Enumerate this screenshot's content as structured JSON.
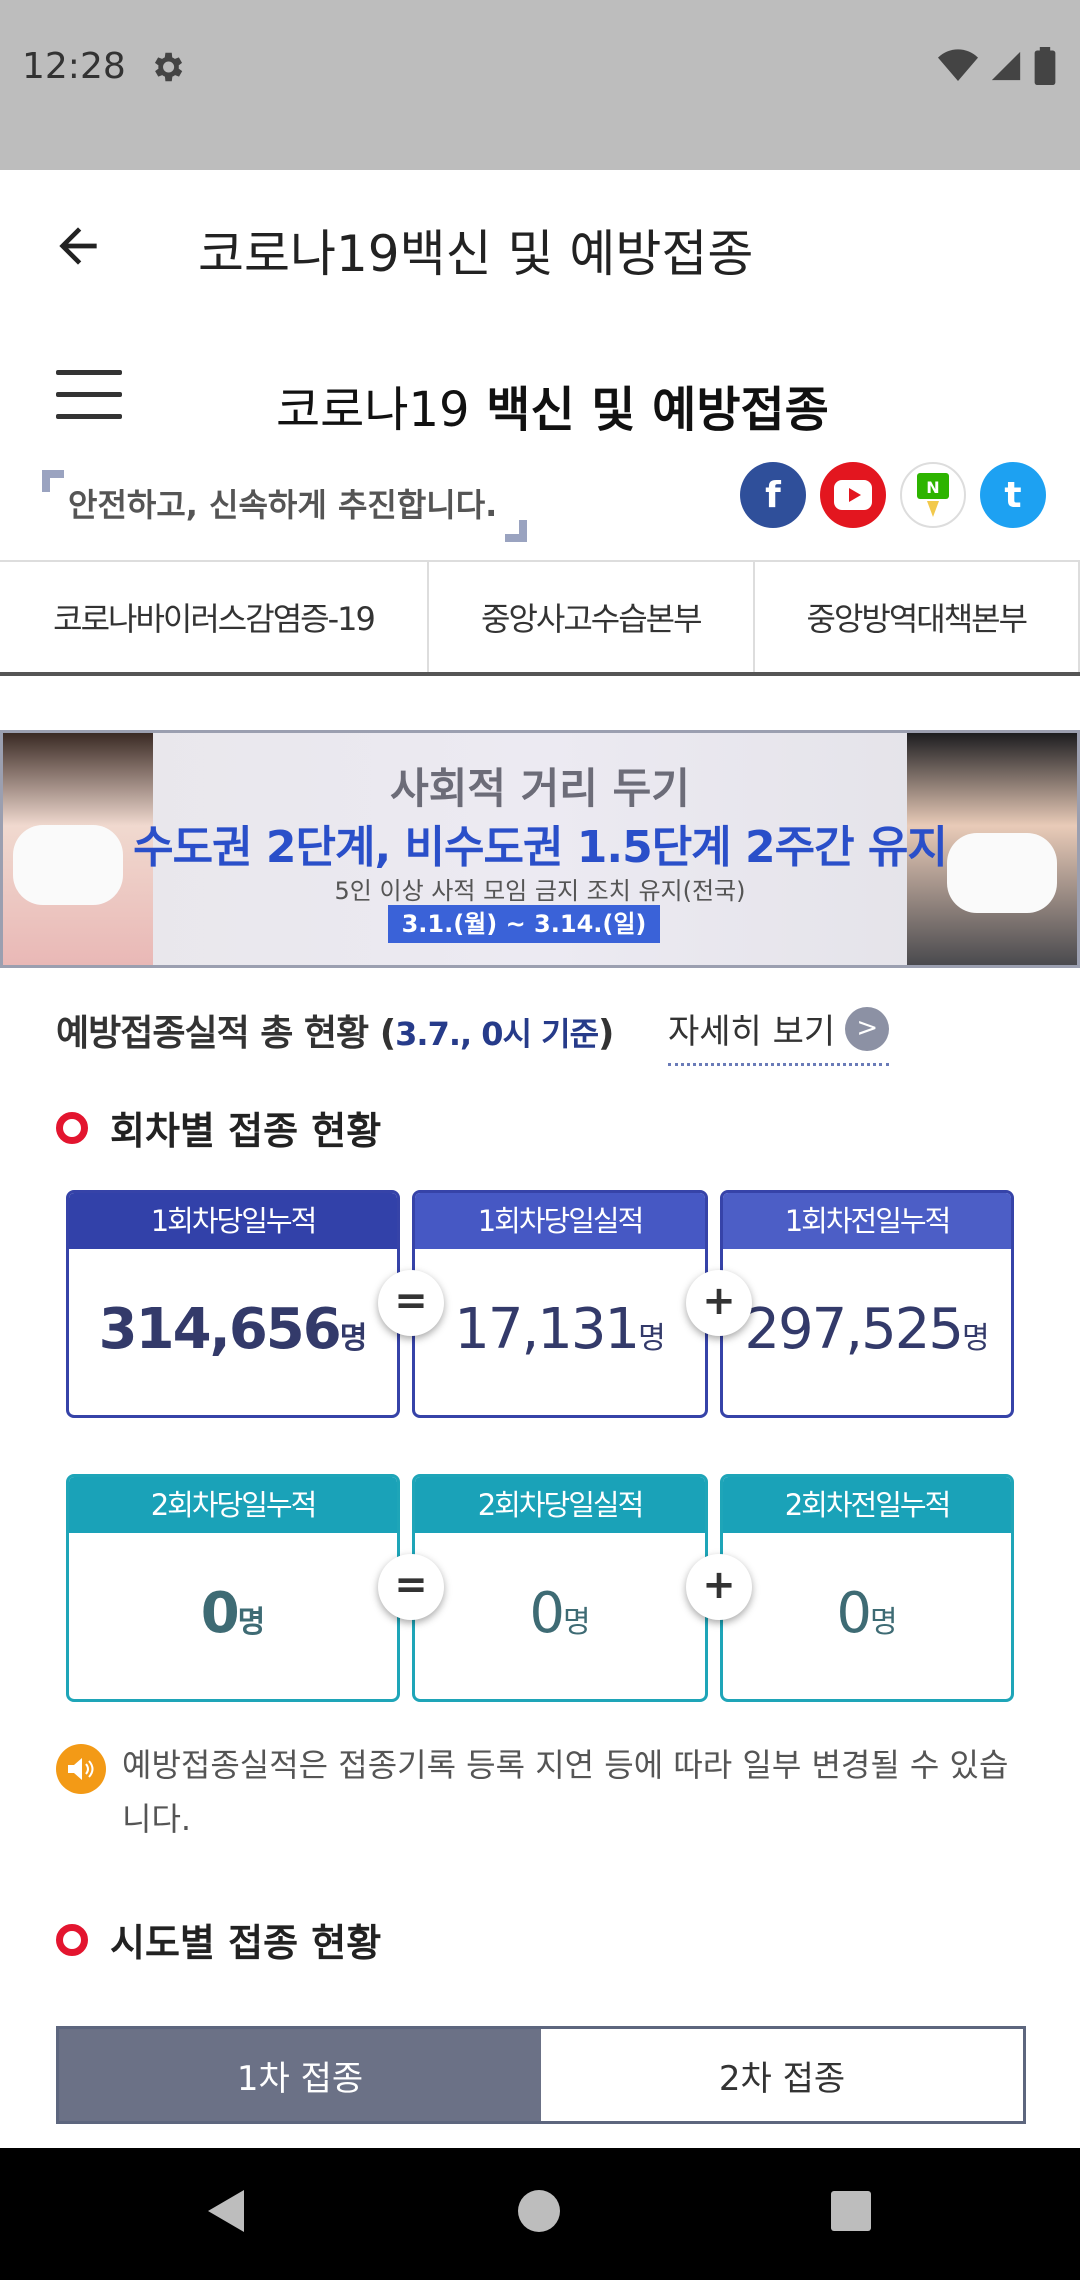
{
  "status_bar": {
    "time": "12:28",
    "icons": [
      "gear-icon",
      "wifi-icon",
      "signal-icon",
      "battery-icon"
    ]
  },
  "app_bar": {
    "title": "코로나19백신 및 예방접종"
  },
  "site": {
    "title_light": "코로나19",
    "title_bold": "백신 및 예방접종",
    "slogan": "안전하고, 신속하게 추진합니다.",
    "social": [
      {
        "name": "facebook",
        "glyph": "f",
        "color": "#2f4f9a"
      },
      {
        "name": "youtube",
        "glyph": "▶",
        "color": "#e3161f"
      },
      {
        "name": "naver-blog",
        "glyph": "N",
        "color": "#ffffff"
      },
      {
        "name": "twitter",
        "glyph": "t",
        "color": "#1da1f2"
      }
    ]
  },
  "tabs": [
    "코로나바이러스감염증-19",
    "중앙사고수습본부",
    "중앙방역대책본부"
  ],
  "banner": {
    "line1": "사회적 거리 두기",
    "line2": "수도권 2단계, 비수도권 1.5단계 2주간 유지",
    "line3": "5인 이상 사적 모임 금지 조치 유지(전국)",
    "line4": "3.1.(월) ~ 3.14.(일)"
  },
  "summary": {
    "label": "예방접종실적 총 현황",
    "date_open": " (",
    "date": "3.7., 0시 기준",
    "date_close": ")",
    "detail_link": "자세히 보기",
    "detail_arrow": ">"
  },
  "dose_section": {
    "title": "회차별 접종 현황"
  },
  "dose1": {
    "cumulative_label": "1회차당일누적",
    "cumulative_value": "314,656",
    "unit": "명",
    "today_label": "1회차당일실적",
    "today_value": "17,131",
    "prev_label": "1회차전일누적",
    "prev_value": "297,525"
  },
  "dose2": {
    "cumulative_label": "2회차당일누적",
    "cumulative_value": "0",
    "unit": "명",
    "today_label": "2회차당일실적",
    "today_value": "0",
    "prev_label": "2회차전일누적",
    "prev_value": "0"
  },
  "operators": {
    "equals": "=",
    "plus": "+"
  },
  "notice": "예방접종실적은 접종기록 등록 지연 등에 따라 일부 변경될 수 있습니다.",
  "region_section": {
    "title": "시도별 접종 현황"
  },
  "region_tabs": {
    "first": "1차 접종",
    "second": "2차 접종"
  }
}
